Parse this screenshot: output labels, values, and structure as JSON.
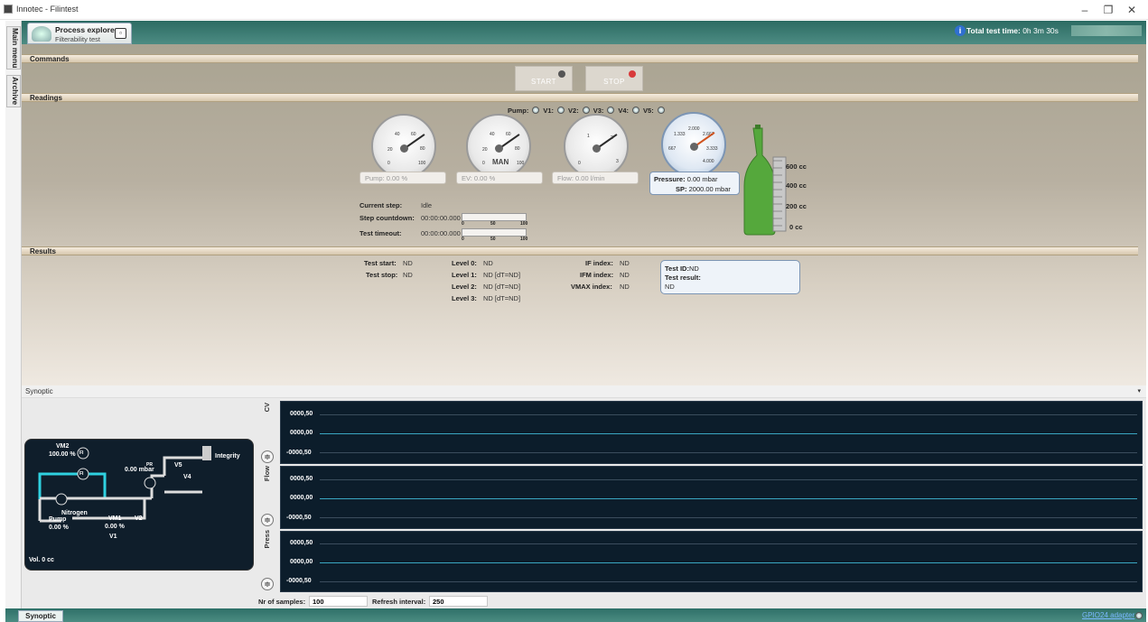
{
  "window": {
    "title": "Innotec - Filintest",
    "min": "–",
    "restore": "❐",
    "close": "✕"
  },
  "left_tabs": [
    "Main menu",
    "Archive"
  ],
  "header": {
    "tab_title": "Process explorer",
    "tab_subtitle": "Filterability test",
    "total_label": "Total test time:",
    "total_value": "0h 3m 30s"
  },
  "sections": {
    "commands": "Commands",
    "readings": "Readings",
    "results": "Results"
  },
  "commands": {
    "start": "START",
    "stop": "STOP"
  },
  "valves": {
    "items": [
      "Pump:",
      "V1:",
      "V2:",
      "V3:",
      "V4:",
      "V5:"
    ]
  },
  "gauges": [
    {
      "label": "Pump:",
      "value": "0.00 %",
      "ticks": [
        "20",
        "40",
        "60",
        "80",
        "100",
        "0"
      ],
      "level": 0
    },
    {
      "label": "EV:",
      "value": "0.00 %",
      "ticks": [
        "20",
        "40",
        "60",
        "80",
        "100",
        "0"
      ],
      "mode": "MAN",
      "level": 0
    },
    {
      "label": "Flow:",
      "value": "0.00 l/min",
      "ticks": [
        "1",
        "2",
        "3",
        "0"
      ],
      "level": 0
    }
  ],
  "pressure_gauge": {
    "ticks": [
      "2.000",
      "1.333",
      "2.667",
      "3.333",
      "667",
      "4.000"
    ],
    "pressure_label": "Pressure:",
    "pressure_value": "0.00 mbar",
    "sp_label": "SP:",
    "sp_value": "2000.00 mbar"
  },
  "bottle": {
    "scale": [
      "600 cc",
      "400 cc",
      "200 cc",
      "0 cc"
    ]
  },
  "status": {
    "current_step_label": "Current step:",
    "current_step": "Idle",
    "countdown_label": "Step countdown:",
    "countdown": "00:00:00.000",
    "timeout_label": "Test timeout:",
    "timeout": "00:00:00.000",
    "bar_ticks": [
      "0",
      "50",
      "100"
    ]
  },
  "results": {
    "test_start_label": "Test start:",
    "test_start": "ND",
    "test_stop_label": "Test stop:",
    "test_stop": "ND",
    "levels": [
      {
        "label": "Level 0:",
        "value": "ND"
      },
      {
        "label": "Level 1:",
        "value": "ND  [dT=ND]"
      },
      {
        "label": "Level 2:",
        "value": "ND  [dT=ND]"
      },
      {
        "label": "Level 3:",
        "value": "ND  [dT=ND]"
      }
    ],
    "indexes": [
      {
        "label": "IF index:",
        "value": "ND"
      },
      {
        "label": "IFM index:",
        "value": "ND"
      },
      {
        "label": "VMAX index:",
        "value": "ND"
      }
    ],
    "test_id_label": "Test ID:",
    "test_id": "ND",
    "test_result_label": "Test result:",
    "test_result": "ND"
  },
  "synoptic": {
    "title": "Synoptic",
    "diagram": {
      "vm2": "VM2",
      "vm2_pct": "100.00 %",
      "fi": "FI",
      "pump": "Pump",
      "pump_pct": "0.00 %",
      "vm1": "VM1",
      "vm1_pct": "0.00 %",
      "v2": "V2",
      "v1": "V1",
      "v4": "V4",
      "v5": "V5",
      "pr": "PR",
      "mbar": "0.00 mbar",
      "integrity": "Integrity",
      "nitrogen": "Nitrogen",
      "vol": "Vol. 0 cc"
    },
    "plots": [
      {
        "name": "CV",
        "ticks": [
          "0000,50",
          "0000,00",
          "-0000,50"
        ]
      },
      {
        "name": "Flow",
        "ticks": [
          "0000,50",
          "0000,00",
          "-0000,50"
        ]
      },
      {
        "name": "Press",
        "ticks": [
          "0000,50",
          "0000,00",
          "-0000,50"
        ]
      }
    ],
    "samples_label": "Nr of samples:",
    "samples_value": "100",
    "refresh_label": "Refresh interval:",
    "refresh_value": "250"
  },
  "statusbar": {
    "tab": "Synoptic",
    "adapter": "GPIO24 adapter"
  }
}
